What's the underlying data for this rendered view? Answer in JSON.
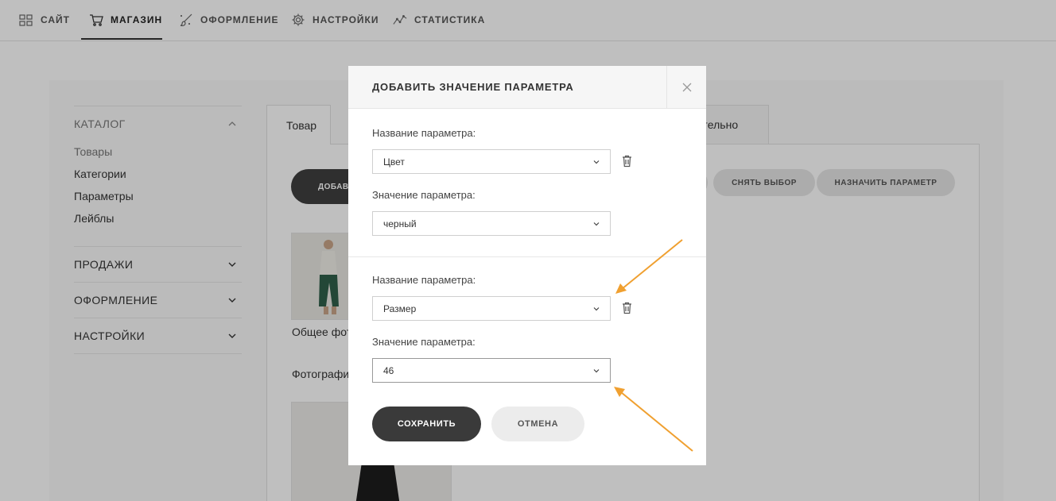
{
  "nav": {
    "items": [
      {
        "label": "САЙТ",
        "icon": "grid-icon"
      },
      {
        "label": "МАГАЗИН",
        "icon": "cart-icon",
        "active": true
      },
      {
        "label": "ОФОРМЛЕНИЕ",
        "icon": "brush-icon"
      },
      {
        "label": "НАСТРОЙКИ",
        "icon": "gear-icon"
      },
      {
        "label": "СТАТИСТИКА",
        "icon": "stats-icon"
      }
    ]
  },
  "sidebar": {
    "catalog": "КАТАЛОГ",
    "links": [
      "Товары",
      "Категории",
      "Параметры",
      "Лейблы"
    ],
    "sections": [
      "ПРОДАЖИ",
      "ОФОРМЛЕНИЕ",
      "НАСТРОЙКИ"
    ]
  },
  "main": {
    "tab_first": "Товар",
    "tab_last": "нительно",
    "add_button": "ДОБАВ",
    "deselect_button": "СНЯТЬ ВЫБОР",
    "assign_button": "НАЗНАЧИТЬ ПАРАМЕТР",
    "caption_general": "Общее фото",
    "caption_photos": "Фотографии"
  },
  "modal": {
    "title": "ДОБАВИТЬ ЗНАЧЕНИЕ ПАРАМЕТРА",
    "param_name_label": "Название параметра:",
    "param_value_label": "Значение параметра:",
    "group1": {
      "name": "Цвет",
      "value": "черный"
    },
    "group2": {
      "name": "Размер",
      "value": "46"
    },
    "save": "СОХРАНИТЬ",
    "cancel": "ОТМЕНА"
  },
  "colors": {
    "accent_arrow": "#f0a030",
    "dark_button": "#3a3a3a"
  }
}
